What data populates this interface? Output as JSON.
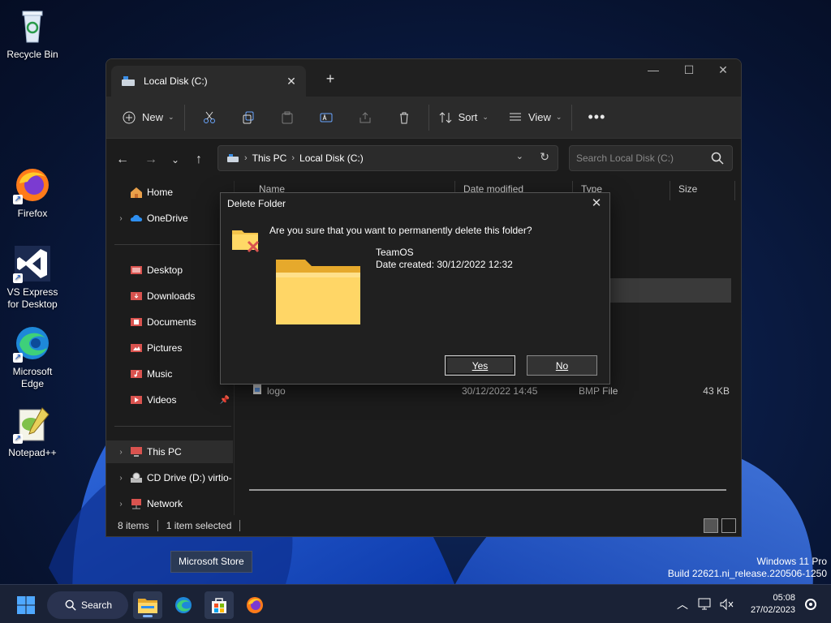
{
  "desktop": {
    "icons": [
      {
        "label": "Recycle Bin"
      },
      {
        "label": "Firefox"
      },
      {
        "label": "VS Express for Desktop"
      },
      {
        "label": "Microsoft Edge"
      },
      {
        "label": "Notepad++"
      }
    ]
  },
  "explorer": {
    "tab_title": "Local Disk (C:)",
    "toolbar": {
      "new_label": "New",
      "sort_label": "Sort",
      "view_label": "View"
    },
    "address": {
      "crumbs": [
        "This PC",
        "Local Disk (C:)"
      ]
    },
    "search": {
      "placeholder": "Search Local Disk (C:)"
    },
    "sidebar": {
      "items": [
        {
          "label": "Home"
        },
        {
          "label": "OneDrive"
        },
        {
          "label": "Desktop"
        },
        {
          "label": "Downloads"
        },
        {
          "label": "Documents"
        },
        {
          "label": "Pictures"
        },
        {
          "label": "Music"
        },
        {
          "label": "Videos"
        },
        {
          "label": "This PC"
        },
        {
          "label": "CD Drive (D:) virtio-"
        },
        {
          "label": "Network"
        }
      ]
    },
    "columns": {
      "name": "Name",
      "date_modified": "Date modified",
      "type": "Type",
      "size": "Size"
    },
    "files": [
      {
        "type_fragment": "ler"
      },
      {
        "type_fragment": "ler"
      },
      {
        "type_fragment": "ler"
      },
      {
        "type_fragment": "ler"
      },
      {
        "type_fragment": "ler"
      },
      {
        "type_fragment": "ler"
      },
      {
        "type_fragment": "ler"
      },
      {
        "name": "logo",
        "date": "30/12/2022 14:45",
        "type": "BMP File",
        "size": "43 KB"
      }
    ],
    "status": {
      "items": "8 items",
      "selected": "1 item selected"
    }
  },
  "dialog": {
    "title": "Delete Folder",
    "question": "Are you sure that you want to permanently delete this folder?",
    "folder_name": "TeamOS",
    "date_created": "Date created: 30/12/2022 12:32",
    "yes_label": "Yes",
    "no_label": "No"
  },
  "tooltip": {
    "text": "Microsoft Store"
  },
  "watermark": {
    "line1": "Windows 11 Pro",
    "line2": "Build 22621.ni_release.220506-1250"
  },
  "taskbar": {
    "search_label": "Search",
    "time": "05:08",
    "date": "27/02/2023"
  },
  "colors": {
    "accent": "#7fb3ff",
    "folder": "#f6c445"
  }
}
